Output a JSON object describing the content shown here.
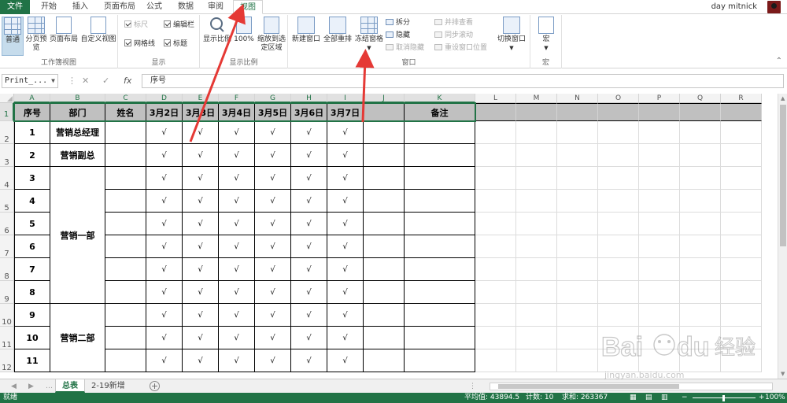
{
  "ribbon_tabs": [
    {
      "label": "文件"
    },
    {
      "label": "开始"
    },
    {
      "label": "插入"
    },
    {
      "label": "页面布局"
    },
    {
      "label": "公式"
    },
    {
      "label": "数据"
    },
    {
      "label": "审阅"
    },
    {
      "label": "视图"
    }
  ],
  "user": {
    "name": "day mitnick"
  },
  "ribbon": {
    "workbook_views": {
      "group_label": "工作簿视图",
      "normal": "普通",
      "page_break": "分页预览",
      "page_layout": "页面布局",
      "custom": "自定义视图"
    },
    "show": {
      "group_label": "显示",
      "ruler": "标尺",
      "formula_bar": "编辑栏",
      "gridlines": "网格线",
      "headings": "标题"
    },
    "zoom": {
      "group_label": "显示比例",
      "zoom": "显示比例",
      "zoom100": "100%",
      "zoom_selection": "缩放到选定区域"
    },
    "window": {
      "group_label": "窗口",
      "new_window": "新建窗口",
      "arrange_all": "全部重排",
      "freeze_panes": "冻结窗格",
      "split": "拆分",
      "hide": "隐藏",
      "unhide": "取消隐藏",
      "side_by_side": "并排查看",
      "sync_scroll": "同步滚动",
      "reset_position": "重设窗口位置",
      "switch_windows": "切换窗口"
    },
    "macros": {
      "group_label": "宏",
      "macros": "宏"
    }
  },
  "formula_bar": {
    "name_box": "Print_...",
    "fx": "fx",
    "content": "序号"
  },
  "columns": [
    "A",
    "B",
    "C",
    "D",
    "E",
    "F",
    "G",
    "H",
    "I",
    "J",
    "K",
    "L",
    "M",
    "N",
    "O",
    "P",
    "Q",
    "R"
  ],
  "rows": [
    "1",
    "2",
    "3",
    "4",
    "5",
    "6",
    "7",
    "8",
    "9",
    "10",
    "11",
    "12"
  ],
  "table": {
    "headers": [
      "序号",
      "部门",
      "姓名",
      "3月2日",
      "3月3日",
      "3月4日",
      "3月5日",
      "3月6日",
      "3月7日",
      "",
      "备注"
    ],
    "serials": [
      "1",
      "2",
      "3",
      "4",
      "5",
      "6",
      "7",
      "8",
      "9",
      "10",
      "11"
    ],
    "departments": [
      {
        "label": "营销总经理"
      },
      {
        "label": "营销副总"
      },
      {
        "label": "营销一部"
      },
      {
        "label": "营销二部"
      }
    ],
    "check_mark": "√"
  },
  "sheets": [
    {
      "label": "总表"
    },
    {
      "label": "2-19新增"
    }
  ],
  "status": {
    "ready": "就绪",
    "average": "平均值: 43894.5",
    "count": "计数: 10",
    "sum": "求和: 263367",
    "zoom": "100%"
  },
  "watermark": {
    "text": "Bai du 经验",
    "url": "jingyan.baidu.com"
  }
}
